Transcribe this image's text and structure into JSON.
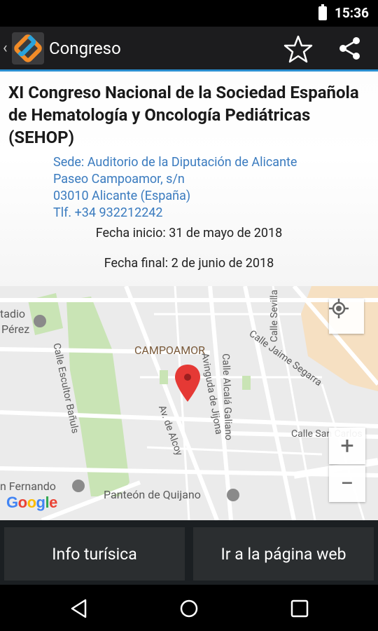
{
  "status_bar": {
    "time": "15:36"
  },
  "app_bar": {
    "title": "Congreso"
  },
  "event": {
    "title": "XI Congreso Nacional de la Sociedad Española de Hematología y Oncología Pediátricas (SEHOP)",
    "venue_lines": [
      "Sede: Auditorio de la Diputación de Alicante",
      "Paseo Campoamor, s/n",
      "03010 Alicante (España)",
      "Tlf. +34 932212242"
    ],
    "start_label": "Fecha inicio:",
    "start_date": "31 de mayo de 2018",
    "end_label": "Fecha final:",
    "end_date": "2 de junio de 2018"
  },
  "map": {
    "labels": {
      "estadio": "tadio",
      "perez": "Pérez",
      "campoamor": "CAMPOAMOR",
      "calle_jaime_segarra": "Calle Jaime Segarra",
      "calle_escultor": "Calle Escultor Bañuls",
      "calle_alcala_galiano": "Calle Alcalá Galiano",
      "calle_sevilla": "Calle Sevilla",
      "avenida_jijona": "Avinguda de Jijona",
      "av_alcoy": "Av. de Alcoy",
      "calle_san_carlos": "Calle San Carlos",
      "san_fernando": "n Fernando",
      "panteon": "Panteón de Quijano",
      "google": "Google"
    },
    "zoom_in": "+",
    "zoom_out": "−"
  },
  "actions": {
    "info_turistica": "Info turísica",
    "pagina_web": "Ir a la página web"
  },
  "colors": {
    "accent": "#2a8ed0",
    "venue_link": "#3a7bbf",
    "pin": "#e53935"
  }
}
